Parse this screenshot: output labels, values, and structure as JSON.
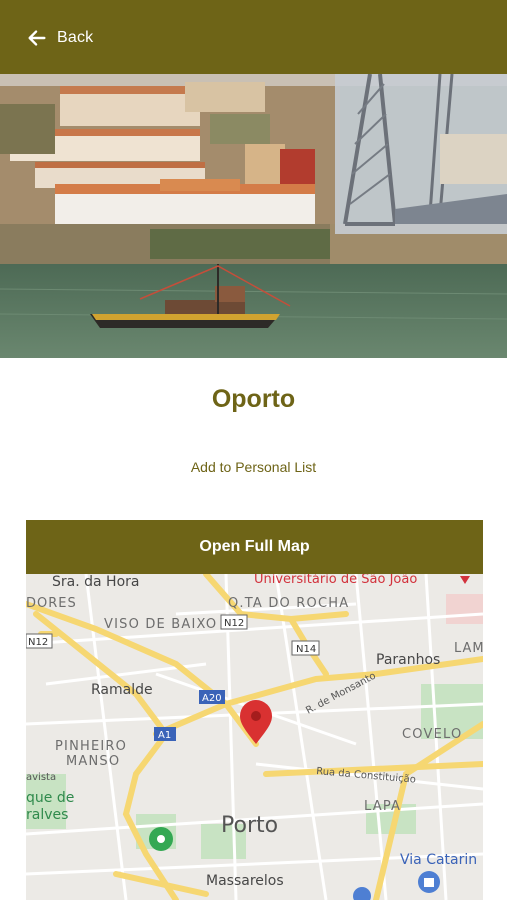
{
  "header": {
    "back_label": "Back",
    "icon": "arrow-left-icon"
  },
  "hero": {
    "alt_subject": "riverside town with boat and iron bridge"
  },
  "place": {
    "title": "Oporto",
    "add_list_label": "Add to Personal List"
  },
  "map": {
    "open_button_label": "Open Full Map",
    "labels": {
      "sra_da_hora": "Sra. da Hora",
      "universitario": "Universitário de São João",
      "dores": "DORES",
      "qta_rocha": "Q.TA DO ROCHA",
      "viso": "VISO DE BAIXO",
      "n12a": "N12",
      "n12b": "N12",
      "n14": "N14",
      "paranhos": "Paranhos",
      "lam": "LAM",
      "ramalde": "Ramalde",
      "a20": "A20",
      "monsanto": "R. de Monsanto",
      "a1": "A1",
      "pinheiro": "PINHEIRO",
      "manso": "MANSO",
      "covelo": "COVELO",
      "avista": "avista",
      "constituicao": "Rua da Constituição",
      "que_de": "que de",
      "ralves": "ralves",
      "lapa": "LAPA",
      "porto": "Porto",
      "via_catarin": "Via Catarin",
      "massarelos": "Massarelos"
    },
    "colors": {
      "pin": "#d93131",
      "road_major": "#f6d772",
      "road_minor": "#ffffff",
      "park": "#c8e3c3"
    }
  },
  "colors": {
    "brand": "#6e6417",
    "background": "#ffffff"
  }
}
